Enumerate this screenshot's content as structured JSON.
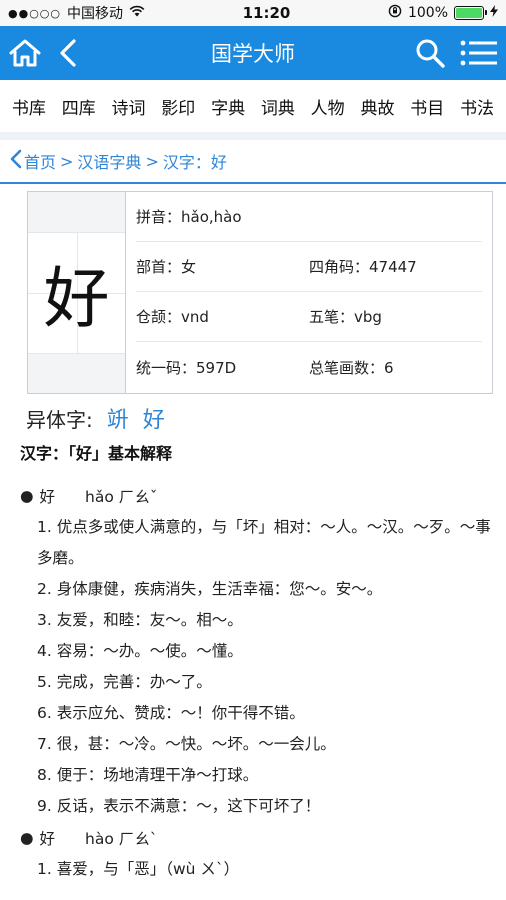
{
  "status_bar": {
    "signal": "●●○○○",
    "carrier": "中国移动",
    "time": "11:20",
    "battery": "100%",
    "battery_level": 1.0
  },
  "nav": {
    "title": "国学大师",
    "icons": [
      "home-icon",
      "back-icon",
      "search-icon",
      "menu-icon"
    ]
  },
  "categories": [
    "书库",
    "四库",
    "诗词",
    "影印",
    "字典",
    "词典",
    "人物",
    "典故",
    "书目",
    "书法"
  ],
  "breadcrumb": {
    "home": "首页",
    "sep1": ">",
    "dict": "汉语字典",
    "sep2": ">",
    "current": "汉字：好"
  },
  "character": {
    "glyph": "好",
    "pinyin": "拼音：hǎo,hào",
    "radical": "部首：女",
    "four_corner": "四角码：47447",
    "cangjie": "仓颉：vnd",
    "wubi": "五笔：vbg",
    "unicode": "统一码：597D",
    "strokes": "总笔画数：6"
  },
  "variants": {
    "label": "异体字:",
    "chars": [
      "竔",
      "好"
    ]
  },
  "basic_title": "汉字：「好」基本解释",
  "entries": [
    {
      "bullet": "●",
      "char": "好",
      "reading": "hǎo ㄏㄠˇ",
      "defs": [
        "1. 优点多或使人满意的，与「坏」相对：～人。～汉。～歹。～事多磨。",
        "2. 身体康健，疾病消失，生活幸福：您～。安～。",
        "3. 友爱，和睦：友～。相～。",
        "4. 容易：～办。～使。～懂。",
        "5. 完成，完善：办～了。",
        "6. 表示应允、赞成：～！你干得不错。",
        "7. 很，甚：～冷。～快。～坏。～一会儿。",
        "8. 便于：场地清理干净～打球。",
        "9. 反话，表示不满意：～，这下可坏了！"
      ]
    },
    {
      "bullet": "●",
      "char": "好",
      "reading": "hào ㄏㄠˋ",
      "defs": [
        "1. 喜爱，与「恶」（wù ㄨˋ）"
      ]
    }
  ],
  "colors": {
    "accent": "#1a8ae0",
    "link": "#2f86d6",
    "battery": "#4cd964"
  }
}
